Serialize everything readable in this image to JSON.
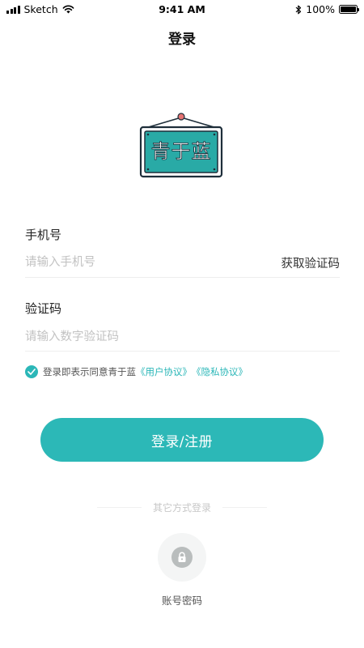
{
  "status_bar": {
    "carrier": "Sketch",
    "time": "9:41 AM",
    "battery": "100%",
    "icons": [
      "signal-icon",
      "wifi-icon",
      "bluetooth-icon",
      "battery-icon"
    ]
  },
  "nav": {
    "title": "登录"
  },
  "logo": {
    "text": "青于蓝",
    "icon": "hanging-sign-logo"
  },
  "phone": {
    "label": "手机号",
    "placeholder": "请输入手机号",
    "value": "",
    "get_code": "获取验证码"
  },
  "code": {
    "label": "验证码",
    "placeholder": "请输入数字验证码",
    "value": ""
  },
  "agreement": {
    "checked": true,
    "text": "登录即表示同意青于蓝",
    "user_agreement": "《用户协议》",
    "privacy_policy": "《隐私协议》"
  },
  "login_button": {
    "label": "登录/注册"
  },
  "other_methods": {
    "title": "其它方式登录",
    "items": [
      {
        "label": "账号密码",
        "icon": "lock-icon"
      }
    ]
  },
  "colors": {
    "accent": "#2cb8b7",
    "logo_board": "#29aaa6",
    "logo_frame": "#1e2e3a",
    "pin": "#e57372",
    "placeholder": "#c2c2c2"
  }
}
